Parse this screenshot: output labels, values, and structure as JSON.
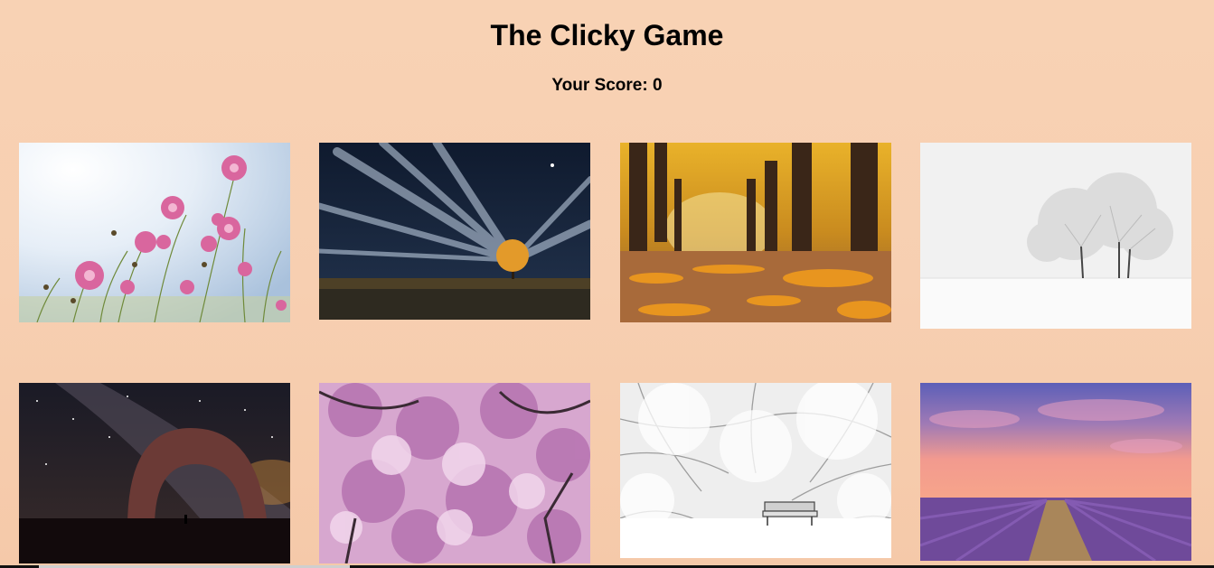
{
  "header": {
    "title": "The Clicky Game",
    "score_label": "Your Score:",
    "score": "0"
  },
  "cards": [
    {
      "subject": "pink cosmos flowers under bright sky"
    },
    {
      "subject": "lone tree under streaking night sky"
    },
    {
      "subject": "autumn tree-lined path with fallen leaves"
    },
    {
      "subject": "frosted tree in white winter field"
    },
    {
      "subject": "stone arch under milky way"
    },
    {
      "subject": "pink cherry blossom canopy"
    },
    {
      "subject": "snow-covered trees over a bench"
    },
    {
      "subject": "lavender field at sunset"
    }
  ]
}
